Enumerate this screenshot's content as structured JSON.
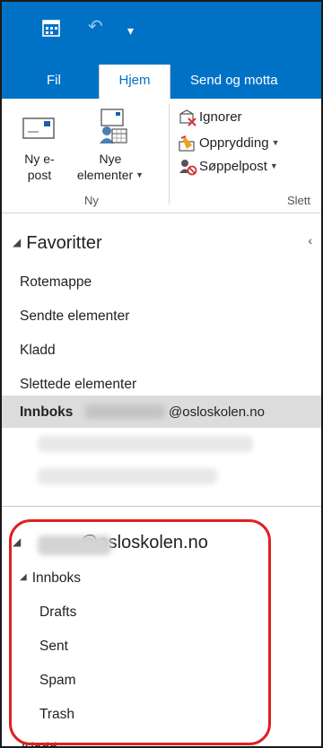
{
  "quick_access": {
    "save_icon": "calendar-save-icon",
    "undo_icon": "undo-icon",
    "more_icon": "customize-caret-icon"
  },
  "tabs": [
    {
      "label": "Fil"
    },
    {
      "label": "Hjem"
    },
    {
      "label": "Send og motta"
    }
  ],
  "ribbon": {
    "new_mail_line1": "Ny e-",
    "new_mail_line2": "post",
    "new_items_line1": "Nye",
    "new_items_line2": "elementer",
    "group_new": "Ny",
    "ignore": "Ignorer",
    "cleanup": "Opprydding",
    "junk": "Søppelpost",
    "group_delete": "Slett"
  },
  "favorites": {
    "header": "Favoritter",
    "items": [
      "Rotemappe",
      "Sendte elementer",
      "Kladd",
      "Slettede elementer"
    ],
    "inbox_label": "Innboks",
    "inbox_account_suffix": "@osloskolen.no"
  },
  "account": {
    "name_suffix": "@osloskolen.no",
    "inbox": "Innboks",
    "subfolders": [
      "Drafts",
      "Sent",
      "Spam",
      "Trash"
    ],
    "kladd": "Kladd"
  },
  "colors": {
    "brand": "#0072c6",
    "highlight": "#e02020"
  }
}
